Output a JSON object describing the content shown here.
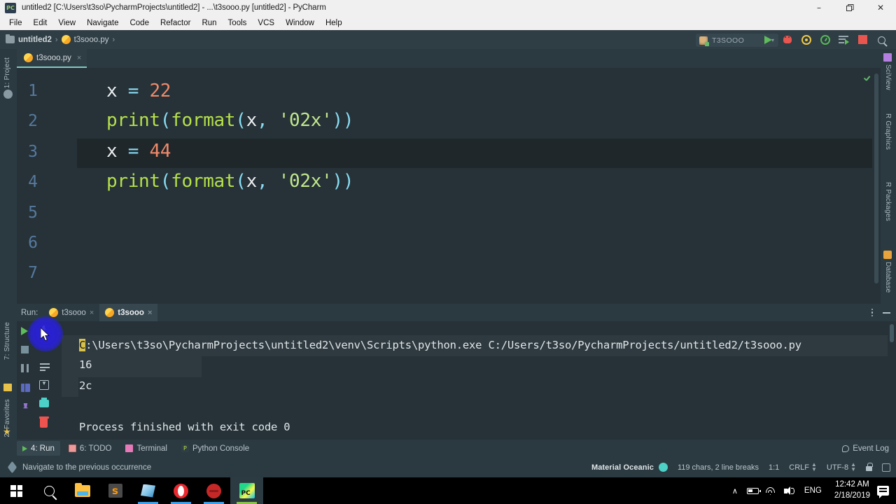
{
  "window": {
    "title": "untitled2 [C:\\Users\\t3so\\PycharmProjects\\untitled2] - ...\\t3sooo.py [untitled2] - PyCharm",
    "app_icon": "pycharm-icon",
    "minimize": "–",
    "restore": "❐",
    "close": "✕"
  },
  "menubar": {
    "items": [
      {
        "label": "File"
      },
      {
        "label": "Edit"
      },
      {
        "label": "View"
      },
      {
        "label": "Navigate"
      },
      {
        "label": "Code"
      },
      {
        "label": "Refactor"
      },
      {
        "label": "Run"
      },
      {
        "label": "Tools"
      },
      {
        "label": "VCS"
      },
      {
        "label": "Window"
      },
      {
        "label": "Help"
      }
    ]
  },
  "navbar": {
    "breadcrumbs": [
      {
        "label": "untitled2",
        "icon": "folder-icon"
      },
      {
        "label": "t3sooo.py",
        "icon": "python-file-icon"
      }
    ],
    "separator": "›",
    "run_config": {
      "name": "T3SOOO",
      "caret": "▾"
    },
    "buttons": [
      {
        "name": "run-button",
        "title": "Run"
      },
      {
        "name": "debug-button",
        "title": "Debug"
      },
      {
        "name": "run-coverage-button",
        "title": "Run with Coverage"
      },
      {
        "name": "profile-button",
        "title": "Profile"
      },
      {
        "name": "attach-button",
        "title": "Attach"
      },
      {
        "name": "stop-button",
        "title": "Stop"
      },
      {
        "name": "search-everywhere-button",
        "title": "Search Everywhere"
      }
    ]
  },
  "left_strip": {
    "top": [
      {
        "label": "1: Project",
        "icon": "project-icon"
      }
    ],
    "bottom": [
      {
        "label": "7: Structure",
        "icon": "structure-icon"
      },
      {
        "label": "2: Favorites",
        "icon": "star-icon"
      }
    ]
  },
  "right_strip": {
    "items": [
      {
        "label": "SciView",
        "icon": "sciview-icon"
      },
      {
        "label": "R Graphics",
        "icon": "r-graphics-icon"
      },
      {
        "label": "R Packages",
        "icon": "r-packages-icon"
      },
      {
        "label": "Database",
        "icon": "database-icon"
      }
    ]
  },
  "editor": {
    "tab": {
      "label": "t3sooo.py",
      "close": "×",
      "icon": "python-file-icon"
    },
    "gutter_lines": [
      "1",
      "2",
      "3",
      "4",
      "5",
      "6",
      "7"
    ],
    "current_line": 3,
    "inspection_status": "ok-check-icon",
    "lines": [
      {
        "n": 1,
        "tokens": [
          {
            "t": "x",
            "c": "c-var"
          },
          {
            "t": " ",
            "c": "c-var"
          },
          {
            "t": "=",
            "c": "c-op"
          },
          {
            "t": " ",
            "c": "c-var"
          },
          {
            "t": "22",
            "c": "c-num"
          }
        ]
      },
      {
        "n": 2,
        "tokens": [
          {
            "t": "print",
            "c": "c-fn"
          },
          {
            "t": "(",
            "c": "c-paren"
          },
          {
            "t": "format",
            "c": "c-fn"
          },
          {
            "t": "(",
            "c": "c-paren"
          },
          {
            "t": "x",
            "c": "c-var"
          },
          {
            "t": ",",
            "c": "c-paren"
          },
          {
            "t": " ",
            "c": "c-var"
          },
          {
            "t": "'02x'",
            "c": "c-str"
          },
          {
            "t": "))",
            "c": "c-paren"
          }
        ]
      },
      {
        "n": 3,
        "tokens": [
          {
            "t": "x",
            "c": "c-var"
          },
          {
            "t": " ",
            "c": "c-var"
          },
          {
            "t": "=",
            "c": "c-op"
          },
          {
            "t": " ",
            "c": "c-var"
          },
          {
            "t": "44",
            "c": "c-num"
          }
        ]
      },
      {
        "n": 4,
        "tokens": [
          {
            "t": "print",
            "c": "c-fn"
          },
          {
            "t": "(",
            "c": "c-paren"
          },
          {
            "t": "format",
            "c": "c-fn"
          },
          {
            "t": "(",
            "c": "c-paren"
          },
          {
            "t": "x",
            "c": "c-var"
          },
          {
            "t": ",",
            "c": "c-paren"
          },
          {
            "t": " ",
            "c": "c-var"
          },
          {
            "t": "'02x'",
            "c": "c-str"
          },
          {
            "t": "))",
            "c": "c-paren"
          }
        ]
      }
    ],
    "plain_text": [
      "x = 22",
      "print(format(x, '02x'))",
      "x = 44",
      "print(format(x, '02x'))"
    ]
  },
  "run_window": {
    "title": "Run:",
    "tabs": [
      {
        "label": "t3sooo",
        "close": "×",
        "active": false,
        "icon": "python-file-icon"
      },
      {
        "label": "t3sooo",
        "close": "×",
        "active": true,
        "icon": "python-file-icon"
      }
    ],
    "header_actions": [
      {
        "name": "more-options-button",
        "icon": "vertical-dots-icon"
      },
      {
        "name": "hide-panel-button",
        "icon": "minus-icon"
      }
    ],
    "side_buttons": [
      {
        "name": "rerun-button",
        "icon": "play-icon"
      },
      {
        "name": "stop-process-button",
        "icon": "stop-square-icon"
      },
      {
        "name": "pause-output-button",
        "icon": "pause-icon"
      },
      {
        "name": "show-tests-button",
        "icon": "grid-icon"
      },
      {
        "name": "pin-tab-button",
        "icon": "pin-icon"
      },
      {
        "name": "up-down-navigate-button",
        "icon": "up-down-arrow-icon"
      },
      {
        "name": "soft-wrap-button",
        "icon": "wrap-lines-icon"
      },
      {
        "name": "scroll-to-end-button",
        "icon": "scroll-end-icon"
      },
      {
        "name": "print-button",
        "icon": "printer-icon"
      },
      {
        "name": "clear-all-button",
        "icon": "trash-icon"
      }
    ],
    "console": {
      "command_prefix_highlight": "C",
      "command": ":\\Users\\t3so\\PycharmProjects\\untitled2\\venv\\Scripts\\python.exe C:/Users/t3so/PycharmProjects/untitled2/t3sooo.py",
      "output": [
        "16",
        "2c"
      ],
      "exit_message": "Process finished with exit code 0"
    }
  },
  "bottom_bar": {
    "items": [
      {
        "label": "4: Run",
        "accel": "4",
        "icon": "run-icon",
        "active": true
      },
      {
        "label": "6: TODO",
        "accel": "6",
        "icon": "todo-icon",
        "active": false
      },
      {
        "label": "Terminal",
        "icon": "terminal-icon",
        "active": false
      },
      {
        "label": "Python Console",
        "icon": "python-console-icon",
        "active": false
      }
    ],
    "event_log": {
      "label": "Event Log",
      "icon": "event-log-icon"
    }
  },
  "status_bar": {
    "message": "Navigate to the previous occurrence",
    "message_icon": "diamond-icon",
    "theme": "Material Oceanic",
    "theme_color": "#4dd0c7",
    "char_count": "119 chars, 2 line breaks",
    "caret_position": "1:1",
    "line_separator": "CRLF",
    "encoding": "UTF-8",
    "lock_icon": "lock-icon",
    "inspector_icon": "inspector-icon"
  },
  "taskbar": {
    "items": [
      {
        "name": "start-button",
        "icon": "windows-logo-icon"
      },
      {
        "name": "search-button",
        "icon": "search-icon"
      },
      {
        "name": "file-explorer-button",
        "icon": "folder-icon"
      },
      {
        "name": "sublime-text-button",
        "icon": "sublime-icon",
        "glyph": "ѕ"
      },
      {
        "name": "store-button",
        "icon": "store-icon",
        "open": true
      },
      {
        "name": "opera-button",
        "icon": "opera-icon",
        "open": true
      },
      {
        "name": "recorder-button",
        "icon": "recorder-icon",
        "open": true
      },
      {
        "name": "pycharm-button",
        "icon": "pycharm-icon",
        "glyph": "PC",
        "active": true
      }
    ],
    "tray": {
      "chevron": "∧",
      "language": "ENG",
      "time": "12:42 AM",
      "date": "2/18/2019",
      "icons": [
        "battery-icon",
        "wifi-icon",
        "volume-icon",
        "notifications-icon"
      ]
    }
  },
  "cursor": {
    "click_indicator": true
  }
}
